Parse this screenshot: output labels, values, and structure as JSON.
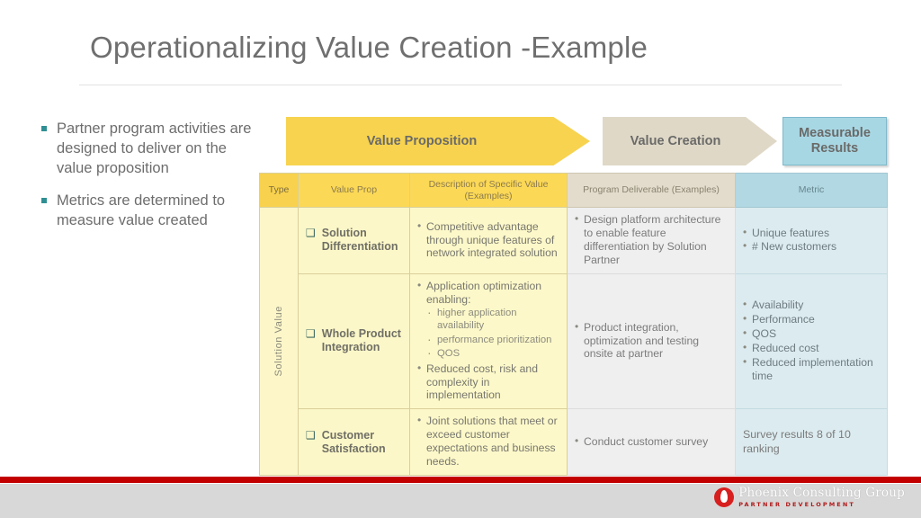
{
  "slide": {
    "title": "Operationalizing Value Creation -Example"
  },
  "bullets": [
    "Partner program activities are designed to deliver on the value proposition",
    "Metrics are determined to measure value created"
  ],
  "banner": {
    "value_proposition": "Value Proposition",
    "value_creation": "Value Creation",
    "measurable_results": "Measurable Results"
  },
  "table": {
    "headers": {
      "type": "Type",
      "value_prop": "Value Prop",
      "description": "Description  of Specific Value (Examples)",
      "deliverable": "Program Deliverable (Examples)",
      "metric": "Metric"
    },
    "type_label": "Solution Value",
    "checkbox_glyph": "❑",
    "rows": [
      {
        "value_prop": "Solution Differentiation",
        "description": [
          "Competitive advantage through unique features of network integrated solution"
        ],
        "deliverable": [
          "Design platform architecture to enable feature differentiation by Solution Partner"
        ],
        "metric": [
          "Unique features",
          "# New customers"
        ]
      },
      {
        "value_prop": "Whole Product Integration",
        "description": [
          "Application optimization enabling:",
          "Reduced cost, risk and complexity in implementation"
        ],
        "description_sub": [
          "higher application availability",
          "performance prioritization",
          "QOS"
        ],
        "deliverable": [
          "Product integration, optimization and testing onsite at partner"
        ],
        "metric": [
          "Availability",
          "Performance",
          "QOS",
          "Reduced cost",
          "Reduced implementation time"
        ]
      },
      {
        "value_prop": "Customer Satisfaction",
        "description": [
          "Joint solutions that meet or exceed customer expectations and business needs."
        ],
        "deliverable": [
          "Conduct customer survey"
        ],
        "metric_plain": "Survey results 8 of 10 ranking"
      }
    ]
  },
  "footer": {
    "logo_name": "Phoenix Consulting Group",
    "logo_tagline": "PARTNER DEVELOPMENT"
  },
  "colors": {
    "accent_yellow": "#f7d34f",
    "accent_beige": "#dfd8c7",
    "accent_blue": "#a8d7e4",
    "bullet_teal": "#2f8f93",
    "footer_red": "#c20000",
    "title_gray": "#6f6f6f"
  }
}
